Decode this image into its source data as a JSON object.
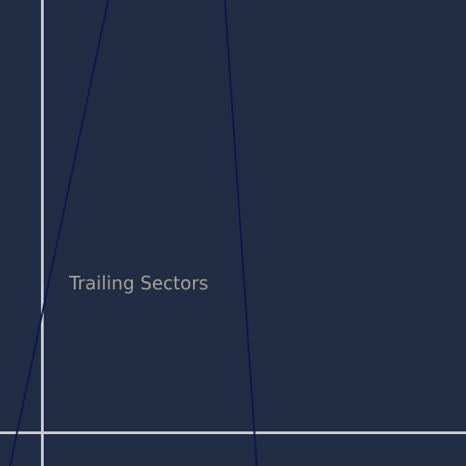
{
  "scene": {
    "background_color": "#212d45",
    "guide_line_color": "#c9ccd2",
    "stroke_line_color": "#0f1650",
    "label_color": "#a3a293",
    "label_text": "Trailing Sectors"
  }
}
